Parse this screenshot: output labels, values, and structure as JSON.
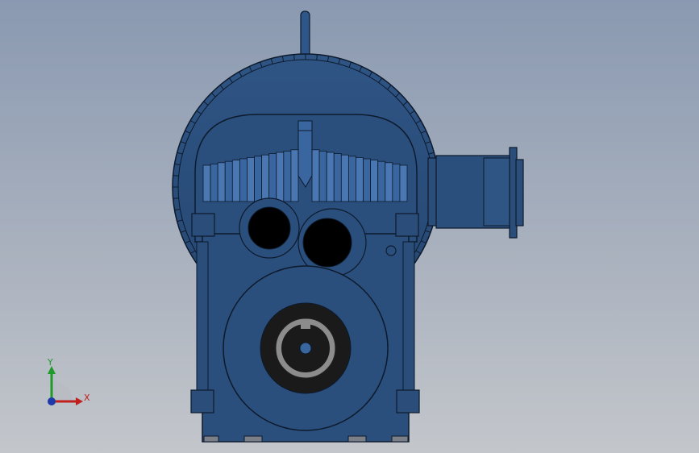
{
  "view": {
    "background_top": "#8a99b1",
    "background_bottom": "#c3c6cb"
  },
  "model": {
    "name": "gear-reducer-front-view",
    "body_color": "#2a4d7a",
    "edge_color": "#0d1a2c",
    "highlight_color": "#36629a",
    "bore_color": "#000000",
    "shaft_color": "#8c8c8c"
  },
  "triad": {
    "x_label": "X",
    "y_label": "Y",
    "x_color": "#c0201e",
    "y_color": "#1e9a2a",
    "z_color": "#1e3aa8"
  }
}
